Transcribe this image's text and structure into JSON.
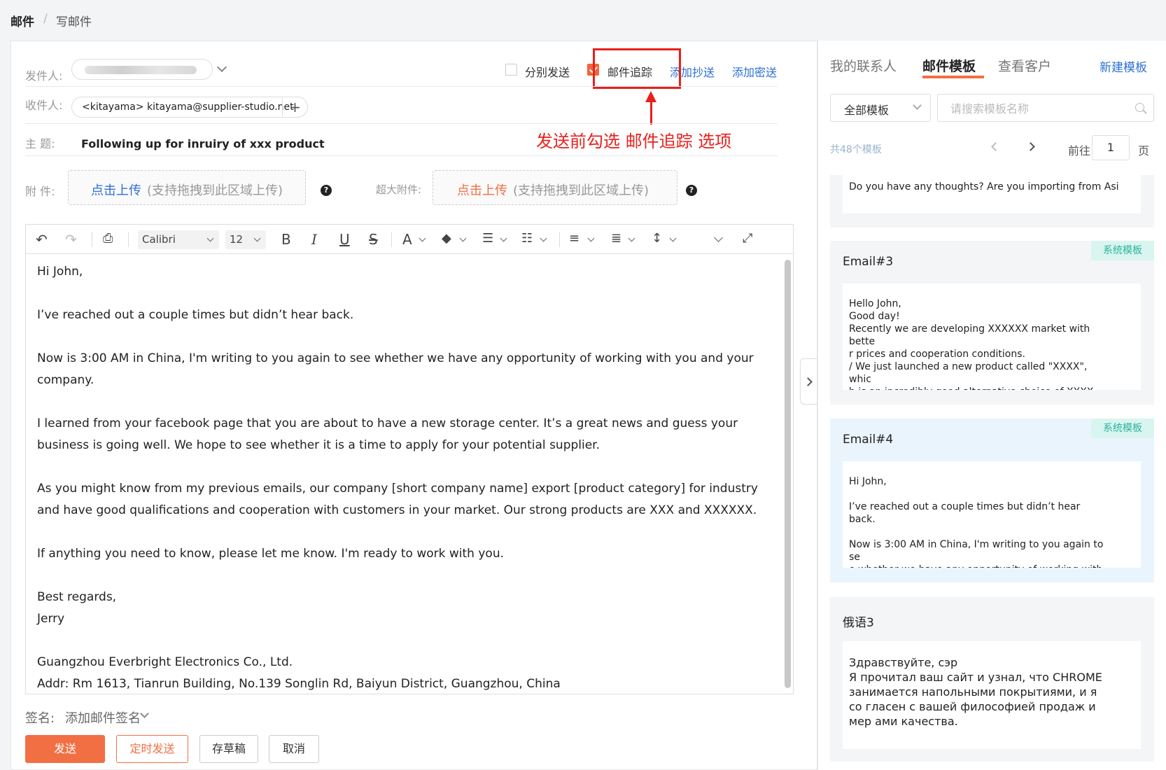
{
  "breadcrumb": {
    "root": "邮件",
    "separator": "/",
    "current": "写邮件"
  },
  "compose": {
    "sender_label": "发件人:",
    "recipient_label": "收件人:",
    "recipient_value": "<kitayama> kitayama@supplier-studio.net",
    "subject_label": "主   题:",
    "subject_value": "Following up for inruiry of xxx product",
    "separate_send_label": "分别发送",
    "separate_send_checked": false,
    "tracking_label": "邮件追踪",
    "tracking_checked": true,
    "add_cc": "添加抄送",
    "add_bcc": "添加密送",
    "annotation": "发送前勾选 邮件追踪 选项",
    "attach_label": "附   件:",
    "attach_upload": "点击上传",
    "attach_hint": "(支持拖拽到此区域上传)",
    "large_attach_label": "超大附件:",
    "large_attach_upload": "点击上传",
    "large_attach_hint": "(支持拖拽到此区域上传)",
    "help_glyph": "?"
  },
  "toolbar": {
    "font": "Calibri",
    "size": "12",
    "bold": "B",
    "italic": "I",
    "underline": "U",
    "strike": "S",
    "font_color": "A",
    "icons": [
      "undo-icon",
      "redo-icon",
      "clear-format-icon",
      "bold-icon",
      "italic-icon",
      "underline-icon",
      "strikethrough-icon",
      "font-color-icon",
      "highlight-icon",
      "ordered-list-icon",
      "bullet-list-icon",
      "align-icon",
      "paragraph-icon",
      "line-height-icon",
      "more-icon",
      "fullscreen-icon"
    ]
  },
  "body": {
    "paragraphs": [
      "Hi John,",
      "",
      "I’ve reached out a couple times but didn’t hear back.",
      "",
      "Now is 3:00 AM in China, I'm writing to you again to see whether we have any opportunity of working with you and your company.",
      "",
      "I learned from your facebook page that you are about to have a new storage center. It’s a great news and guess your business is going well. We hope to see whether it is a time to apply for your potential supplier.",
      "",
      "As you might know from my previous emails, our company [short company name] export [product category] for industry and have good qualifications and cooperation with customers in your market. Our strong products are XXX and XXXXXX.",
      "",
      "If anything you need to know, please let me know. I'm ready to work with you.",
      "",
      "Best regards,",
      "Jerry",
      "",
      "Guangzhou Everbright Electronics Co., Ltd.",
      "Addr: Rm 1613, Tianrun Building, No.139 Songlin Rd, Baiyun District, Guangzhou, China"
    ]
  },
  "signature": {
    "label": "签名:",
    "value": "添加邮件签名"
  },
  "actions": {
    "send": "发送",
    "schedule": "定时发送",
    "draft": "存草稿",
    "cancel": "取消"
  },
  "panel": {
    "tabs": [
      "我的联系人",
      "邮件模板",
      "查看客户"
    ],
    "active_tab": "邮件模板",
    "new_template": "新建模板",
    "filter_value": "全部模板",
    "search_placeholder": "请搜索模板名称",
    "count_text": "共48个模板",
    "goto_label": "前往",
    "page_value": "1",
    "page_unit": "页",
    "cards": [
      {
        "title": "",
        "tag": "",
        "preview": "Do you have any thoughts? Are you importing from Asi"
      },
      {
        "title": "Email#3",
        "tag": "系统模板",
        "preview": "Hello John,\nGood day!\nRecently we are developing XXXXXX market with bette\nr prices and cooperation conditions.\n/ We just launched a new product called \"XXXX\", whic\nh is an incredibly good alternative choice of XXXX."
      },
      {
        "title": "Email#4",
        "tag": "系统模板",
        "preview": "Hi John,\n\nI’ve reached out a couple times but didn’t hear back.\n\nNow is 3:00 AM in China, I'm writing to you again to se\ne whether we have any opportunity of working with yo"
      },
      {
        "title": "俄语3",
        "tag": "",
        "preview": "Здравствуйте, сэр\nЯ прочитал ваш сайт и узнал, что CHROME занимается напольными покрытиями, и я со гласен с вашей философией продаж и мер ами качества."
      }
    ]
  },
  "colors": {
    "accent": "#f26f43",
    "link": "#2d6fd6",
    "annotation": "#e8201b",
    "tag_bg": "#d9f5ef",
    "tag_fg": "#2bb39a"
  }
}
